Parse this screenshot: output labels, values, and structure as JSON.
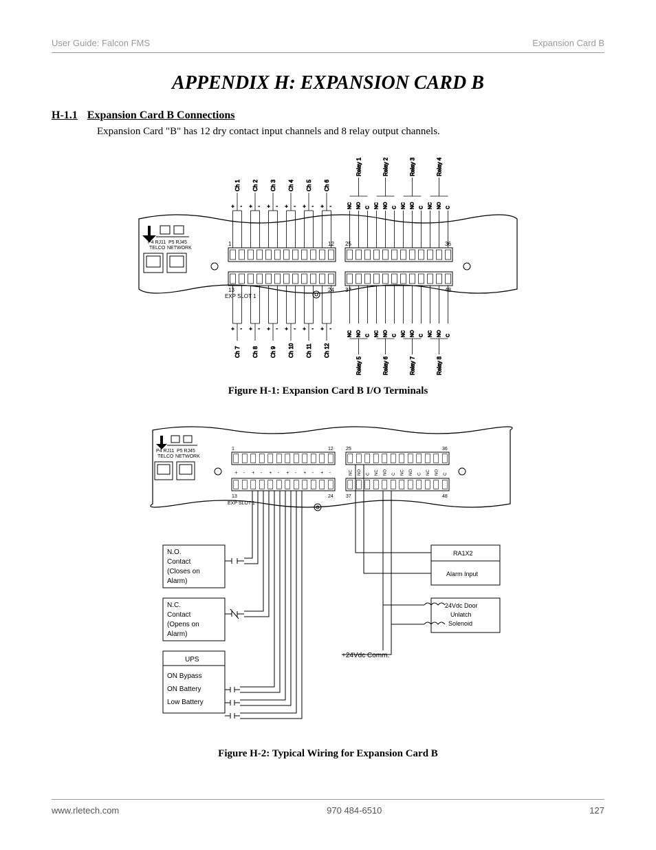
{
  "header": {
    "left": "User Guide: Falcon FMS",
    "right": "Expansion Card B"
  },
  "title": "APPENDIX H: EXPANSION CARD B",
  "section": {
    "num": "H-1.1",
    "name": "Expansion Card B Connections",
    "body": "Expansion Card \"B\" has 12 dry contact input channels and 8 relay output channels."
  },
  "figure1": {
    "caption": "Figure H-1: Expansion Card B I/O Terminals",
    "port_labels": {
      "p4": "P4 RJ11",
      "p4_sub": "TELCO",
      "p5": "P5 RJ45",
      "p5_sub": "NETWORK"
    },
    "exp_slot": "EXP SLOT 1",
    "term_nums": [
      "1",
      "12",
      "25",
      "36",
      "13",
      "24",
      "37",
      "48"
    ],
    "top_channels": [
      "Ch 1",
      "Ch 2",
      "Ch 3",
      "Ch 4",
      "Ch 5",
      "Ch 6"
    ],
    "bottom_channels": [
      "Ch 7",
      "Ch 8",
      "Ch 9",
      "Ch 10",
      "Ch 11",
      "Ch 12"
    ],
    "top_relays": [
      "Relay 1",
      "Relay 2",
      "Relay 3",
      "Relay 4"
    ],
    "bottom_relays": [
      "Relay 5",
      "Relay 6",
      "Relay 7",
      "Relay 8"
    ],
    "relay_pins": [
      "NC",
      "NO",
      "C"
    ],
    "polarity": [
      "+",
      "-"
    ]
  },
  "figure2": {
    "caption": "Figure H-2: Typical Wiring for Expansion Card B",
    "port_labels": {
      "p4": "P4 RJ11",
      "p4_sub": "TELCO",
      "p5": "P5 RJ45",
      "p5_sub": "NETWORK"
    },
    "exp_slot": "EXP SLOT 1",
    "term_nums": [
      "1",
      "12",
      "25",
      "36",
      "13",
      "24",
      "37",
      "48"
    ],
    "polarity": [
      "+",
      "-"
    ],
    "relay_pins": [
      "NC",
      "NO",
      "C"
    ],
    "boxes": {
      "no_contact": [
        "N.O.",
        "Contact",
        "(Closes on",
        "Alarm)"
      ],
      "nc_contact": [
        "N.C.",
        "Contact",
        "(Opens on",
        "Alarm)"
      ],
      "ups_title": "UPS",
      "ups_lines": [
        "ON Bypass",
        "ON Battery",
        "Low Battery"
      ],
      "ra1x2": [
        "RA1X2",
        "Alarm Input"
      ],
      "solenoid": [
        "24Vdc Door",
        "Unlatch",
        "Solenoid"
      ],
      "vdc": "+24Vdc  Comm."
    }
  },
  "footer": {
    "left": "www.rletech.com",
    "center": "970 484-6510",
    "right": "127"
  }
}
